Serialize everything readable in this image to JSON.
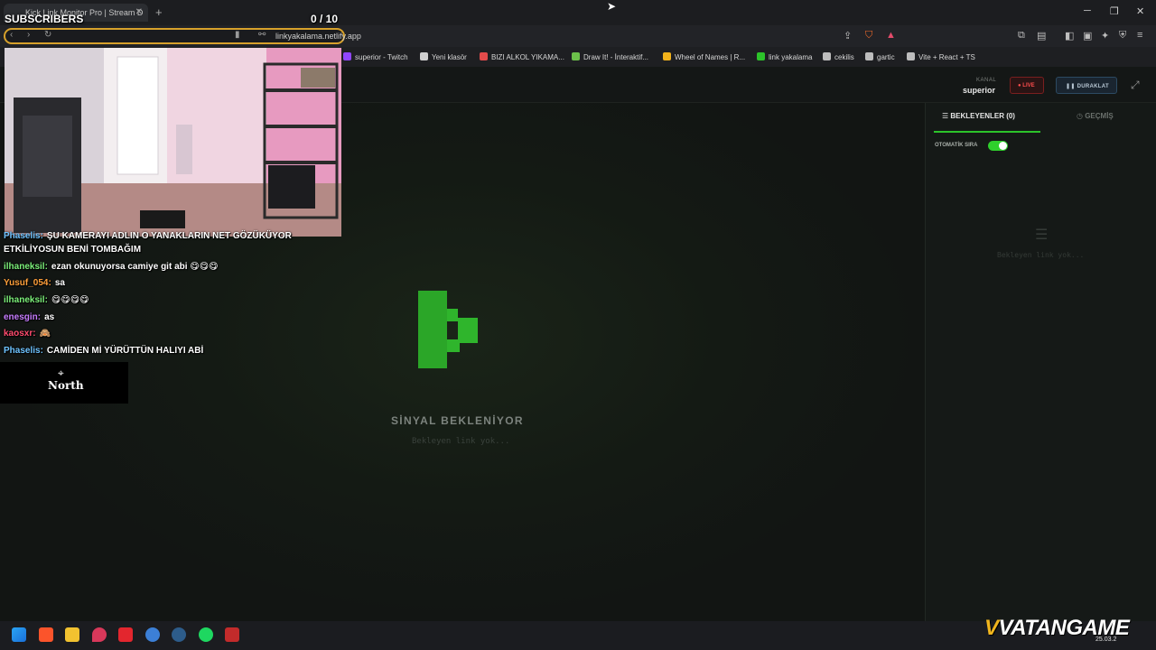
{
  "browser": {
    "tab_title": "Kick Link Monitor Pro | Stream D",
    "url": "linkyakalama.netlify.app",
    "bookmarks": [
      {
        "label": "superior - Twitch",
        "color": "#9146ff"
      },
      {
        "label": "Yeni klasör",
        "color": "#cfcfcf"
      },
      {
        "label": "BIZI ALKOL YIKAMA...",
        "color": "#e34b4b"
      },
      {
        "label": "Draw It! - İnteraktif...",
        "color": "#6cc04a"
      },
      {
        "label": "Wheel of Names | R...",
        "color": "#f2b21b"
      },
      {
        "label": "link yakalama",
        "color": "#2cc32a"
      },
      {
        "label": "cekilis",
        "color": "#bdbdbd"
      },
      {
        "label": "gartic",
        "color": "#bdbdbd"
      },
      {
        "label": "Vite + React + TS",
        "color": "#bdbdbd"
      }
    ]
  },
  "header": {
    "kanal_label": "KANAL",
    "kanal_value": "superior",
    "live_label": "LIVE",
    "pause_label": "DURAKLAT"
  },
  "main": {
    "signal_title": "SİNYAL BEKLENİYOR",
    "signal_sub": "Bekleyen link yok..."
  },
  "sidebar": {
    "tab_waiting": "BEKLEYENLER (0)",
    "tab_history": "GEÇMİŞ",
    "auto_queue_label": "OTOMATİK SIRA",
    "auto_queue_on": true,
    "empty_text": "Bekleyen link yok..."
  },
  "overlay": {
    "subscribers_label": "SUBSCRIBERS",
    "subscribers_count": "0  / 10",
    "chat": [
      {
        "user": "Phaselis:",
        "color": "#6ec3ff",
        "msg": "ŞU KAMERAYI ADLIN O YANAKLARIN NET GÖZÜKÜYOR"
      },
      {
        "user": "",
        "color": "#ffffff",
        "msg": "ETKİLİYOSUN BENİ TOMBAĞIM"
      },
      {
        "user": "ilhaneksil:",
        "color": "#7cf07a",
        "msg": "ezan okunuyorsa camiye git abi 😋😋😋"
      },
      {
        "user": "Yusuf_054:",
        "color": "#ff9f3a",
        "msg": "sa"
      },
      {
        "user": "ilhaneksil:",
        "color": "#7cf07a",
        "msg": "😋😋😋😋"
      },
      {
        "user": "enesgin:",
        "color": "#c77dff",
        "msg": "as"
      },
      {
        "user": "kaosxr:",
        "color": "#ff4b6e",
        "msg": "🙈"
      },
      {
        "user": "Phaselis:",
        "color": "#6ec3ff",
        "msg": "CAMİDEN Mİ YÜRÜTTÜN HALIYI ABİ"
      }
    ],
    "sponsor": "North"
  },
  "watermark": {
    "brand": "VATANGAME",
    "date": "25.03.2"
  }
}
